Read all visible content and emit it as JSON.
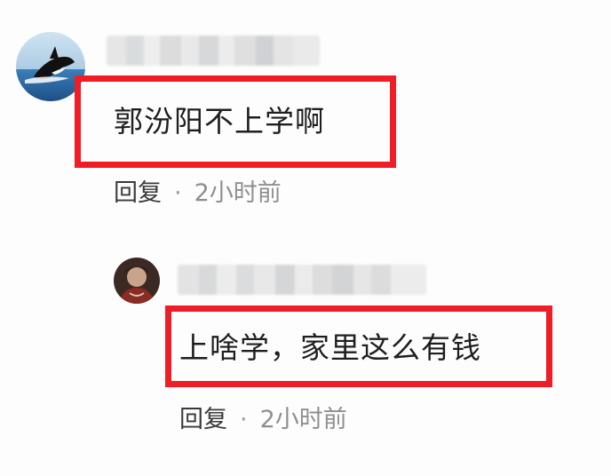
{
  "comments": [
    {
      "text": "郭汾阳不上学啊",
      "reply_label": "回复",
      "separator": "·",
      "time": "2小时前"
    },
    {
      "text": "上啥学，家里这么有钱",
      "reply_label": "回复",
      "separator": "·",
      "time": "2小时前"
    }
  ],
  "colors": {
    "highlight_border": "#ef1d25",
    "reply_text": "#3a3a3a",
    "time_text": "#8f8f8f",
    "background": "#fdfdfd"
  }
}
